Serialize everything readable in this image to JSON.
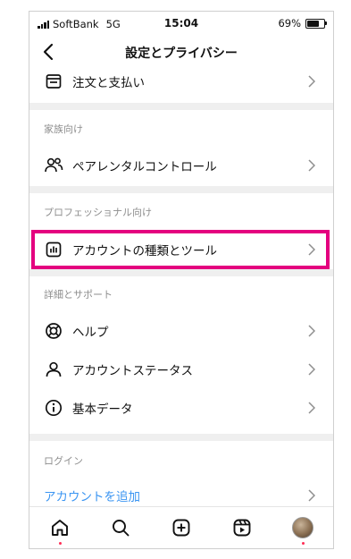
{
  "status_bar": {
    "carrier": "SoftBank",
    "network": "5G",
    "time": "15:04",
    "battery": "69%",
    "battery_level": 0.69
  },
  "nav": {
    "title": "設定とプライバシー"
  },
  "rows": {
    "orders": "注文と支払い",
    "family_header": "家族向け",
    "parental": "ペアレンタルコントロール",
    "professional_header": "プロフェッショナル向け",
    "account_type": "アカウントの種類とツール",
    "support_header": "詳細とサポート",
    "help": "ヘルプ",
    "account_status": "アカウントステータス",
    "basic_data": "基本データ",
    "login_header": "ログイン",
    "add_account": "アカウントを追加"
  },
  "colors": {
    "highlight": "#e4007f",
    "link": "#3b95f2",
    "notification_dot": "#ff2d55"
  },
  "tabs": [
    "home-icon",
    "search-icon",
    "create-icon",
    "reels-icon",
    "profile-avatar"
  ]
}
